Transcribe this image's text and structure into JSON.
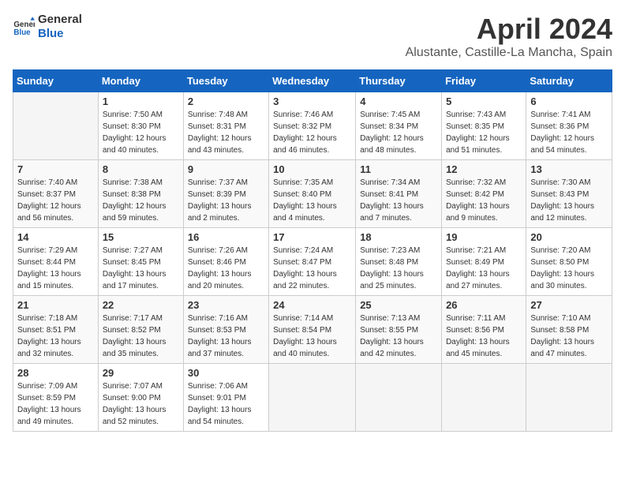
{
  "header": {
    "logo_line1": "General",
    "logo_line2": "Blue",
    "title": "April 2024",
    "subtitle": "Alustante, Castille-La Mancha, Spain"
  },
  "days_of_week": [
    "Sunday",
    "Monday",
    "Tuesday",
    "Wednesday",
    "Thursday",
    "Friday",
    "Saturday"
  ],
  "weeks": [
    [
      {
        "day": "",
        "info": ""
      },
      {
        "day": "1",
        "info": "Sunrise: 7:50 AM\nSunset: 8:30 PM\nDaylight: 12 hours\nand 40 minutes."
      },
      {
        "day": "2",
        "info": "Sunrise: 7:48 AM\nSunset: 8:31 PM\nDaylight: 12 hours\nand 43 minutes."
      },
      {
        "day": "3",
        "info": "Sunrise: 7:46 AM\nSunset: 8:32 PM\nDaylight: 12 hours\nand 46 minutes."
      },
      {
        "day": "4",
        "info": "Sunrise: 7:45 AM\nSunset: 8:34 PM\nDaylight: 12 hours\nand 48 minutes."
      },
      {
        "day": "5",
        "info": "Sunrise: 7:43 AM\nSunset: 8:35 PM\nDaylight: 12 hours\nand 51 minutes."
      },
      {
        "day": "6",
        "info": "Sunrise: 7:41 AM\nSunset: 8:36 PM\nDaylight: 12 hours\nand 54 minutes."
      }
    ],
    [
      {
        "day": "7",
        "info": "Sunrise: 7:40 AM\nSunset: 8:37 PM\nDaylight: 12 hours\nand 56 minutes."
      },
      {
        "day": "8",
        "info": "Sunrise: 7:38 AM\nSunset: 8:38 PM\nDaylight: 12 hours\nand 59 minutes."
      },
      {
        "day": "9",
        "info": "Sunrise: 7:37 AM\nSunset: 8:39 PM\nDaylight: 13 hours\nand 2 minutes."
      },
      {
        "day": "10",
        "info": "Sunrise: 7:35 AM\nSunset: 8:40 PM\nDaylight: 13 hours\nand 4 minutes."
      },
      {
        "day": "11",
        "info": "Sunrise: 7:34 AM\nSunset: 8:41 PM\nDaylight: 13 hours\nand 7 minutes."
      },
      {
        "day": "12",
        "info": "Sunrise: 7:32 AM\nSunset: 8:42 PM\nDaylight: 13 hours\nand 9 minutes."
      },
      {
        "day": "13",
        "info": "Sunrise: 7:30 AM\nSunset: 8:43 PM\nDaylight: 13 hours\nand 12 minutes."
      }
    ],
    [
      {
        "day": "14",
        "info": "Sunrise: 7:29 AM\nSunset: 8:44 PM\nDaylight: 13 hours\nand 15 minutes."
      },
      {
        "day": "15",
        "info": "Sunrise: 7:27 AM\nSunset: 8:45 PM\nDaylight: 13 hours\nand 17 minutes."
      },
      {
        "day": "16",
        "info": "Sunrise: 7:26 AM\nSunset: 8:46 PM\nDaylight: 13 hours\nand 20 minutes."
      },
      {
        "day": "17",
        "info": "Sunrise: 7:24 AM\nSunset: 8:47 PM\nDaylight: 13 hours\nand 22 minutes."
      },
      {
        "day": "18",
        "info": "Sunrise: 7:23 AM\nSunset: 8:48 PM\nDaylight: 13 hours\nand 25 minutes."
      },
      {
        "day": "19",
        "info": "Sunrise: 7:21 AM\nSunset: 8:49 PM\nDaylight: 13 hours\nand 27 minutes."
      },
      {
        "day": "20",
        "info": "Sunrise: 7:20 AM\nSunset: 8:50 PM\nDaylight: 13 hours\nand 30 minutes."
      }
    ],
    [
      {
        "day": "21",
        "info": "Sunrise: 7:18 AM\nSunset: 8:51 PM\nDaylight: 13 hours\nand 32 minutes."
      },
      {
        "day": "22",
        "info": "Sunrise: 7:17 AM\nSunset: 8:52 PM\nDaylight: 13 hours\nand 35 minutes."
      },
      {
        "day": "23",
        "info": "Sunrise: 7:16 AM\nSunset: 8:53 PM\nDaylight: 13 hours\nand 37 minutes."
      },
      {
        "day": "24",
        "info": "Sunrise: 7:14 AM\nSunset: 8:54 PM\nDaylight: 13 hours\nand 40 minutes."
      },
      {
        "day": "25",
        "info": "Sunrise: 7:13 AM\nSunset: 8:55 PM\nDaylight: 13 hours\nand 42 minutes."
      },
      {
        "day": "26",
        "info": "Sunrise: 7:11 AM\nSunset: 8:56 PM\nDaylight: 13 hours\nand 45 minutes."
      },
      {
        "day": "27",
        "info": "Sunrise: 7:10 AM\nSunset: 8:58 PM\nDaylight: 13 hours\nand 47 minutes."
      }
    ],
    [
      {
        "day": "28",
        "info": "Sunrise: 7:09 AM\nSunset: 8:59 PM\nDaylight: 13 hours\nand 49 minutes."
      },
      {
        "day": "29",
        "info": "Sunrise: 7:07 AM\nSunset: 9:00 PM\nDaylight: 13 hours\nand 52 minutes."
      },
      {
        "day": "30",
        "info": "Sunrise: 7:06 AM\nSunset: 9:01 PM\nDaylight: 13 hours\nand 54 minutes."
      },
      {
        "day": "",
        "info": ""
      },
      {
        "day": "",
        "info": ""
      },
      {
        "day": "",
        "info": ""
      },
      {
        "day": "",
        "info": ""
      }
    ]
  ]
}
